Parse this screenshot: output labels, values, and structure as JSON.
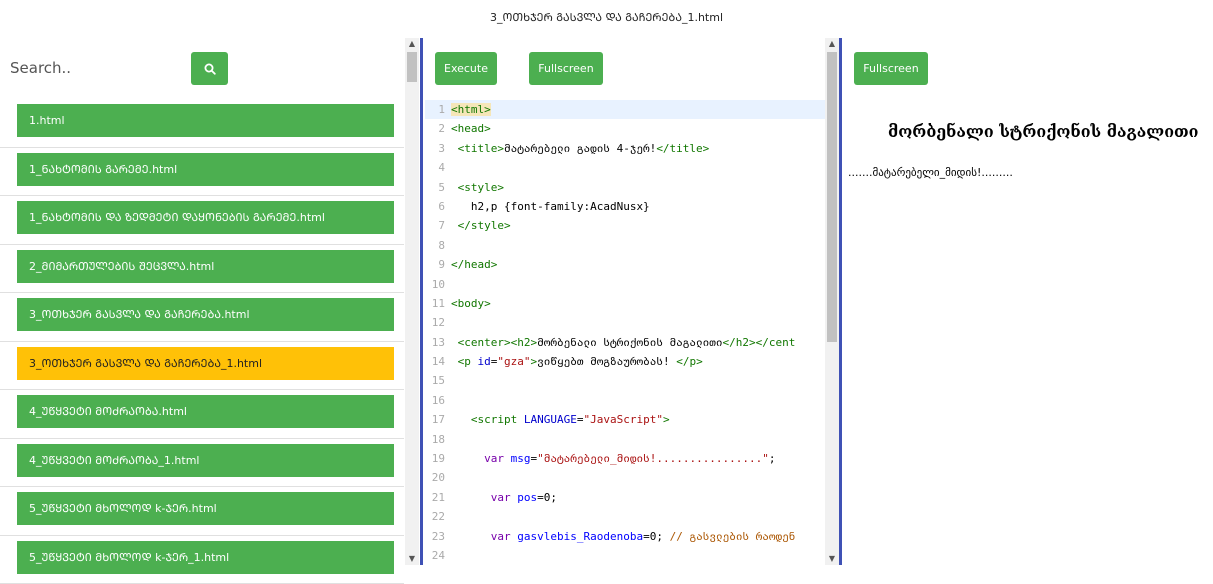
{
  "window": {
    "title": "3_ᲝᲗᲮᲯᲔᲠ ᲒᲐᲡᲕᲚᲐ ᲓᲐ ᲒᲐᲩᲔᲠᲔᲑᲐ_1.html"
  },
  "search": {
    "placeholder": "Search..",
    "icon": "search-icon"
  },
  "files": [
    {
      "label": "1.html"
    },
    {
      "label": "1_ᲜᲐᲮᲢᲝᲛᲘᲡ ᲒᲐᲠᲔᲛᲔ.html"
    },
    {
      "label": "1_ᲜᲐᲮᲢᲝᲛᲘᲡ ᲓᲐ ᲖᲔᲓᲛᲔᲢᲘ ᲓᲐᲧᲝᲜᲔᲑᲘᲡ ᲒᲐᲠᲔᲛᲔ.html"
    },
    {
      "label": "2_ᲛᲘᲛᲐᲠᲗᲣᲚᲔᲑᲘᲡ ᲨᲔᲪᲕᲚᲐ.html"
    },
    {
      "label": "3_ᲝᲗᲮᲯᲔᲠ ᲒᲐᲡᲕᲚᲐ ᲓᲐ ᲒᲐᲩᲔᲠᲔᲑᲐ.html"
    },
    {
      "label": "3_ᲝᲗᲮᲯᲔᲠ ᲒᲐᲡᲕᲚᲐ ᲓᲐ ᲒᲐᲩᲔᲠᲔᲑᲐ_1.html",
      "active": true
    },
    {
      "label": "4_ᲣᲬᲧᲕᲔᲢᲘ ᲛᲝᲫᲠᲐᲝᲑᲐ.html"
    },
    {
      "label": "4_ᲣᲬᲧᲕᲔᲢᲘ ᲛᲝᲫᲠᲐᲝᲑᲐ_1.html"
    },
    {
      "label": "5_ᲣᲬᲧᲕᲔᲢᲘ ᲛᲮᲝᲚᲝᲓ k-ᲯᲔᲠ.html"
    },
    {
      "label": "5_ᲣᲬᲧᲕᲔᲢᲘ ᲛᲮᲝᲚᲝᲓ k-ᲯᲔᲠ_1.html"
    }
  ],
  "toolbar": {
    "execute_label": "Execute",
    "fullscreen_label": "Fullscreen"
  },
  "preview": {
    "fullscreen_label": "Fullscreen",
    "heading": "მორბენალი სტრიქონის მაგალითი",
    "text": ".......მატარებელი_მიდის!........."
  },
  "code": {
    "line_numbers": [
      "1",
      "2",
      "3",
      "4",
      "5",
      "6",
      "7",
      "8",
      "9",
      "10",
      "11",
      "12",
      "13",
      "14",
      "15",
      "16",
      "17",
      "18",
      "19",
      "20",
      "21",
      "22",
      "23",
      "24"
    ],
    "l1": "<html>",
    "l2": "<head>",
    "l3a": "<title>",
    "l3b": "მატარებელი გადის 4-ჯერ!",
    "l3c": "</title>",
    "l5": "<style>",
    "l6": "h2,p {font-family:AcadNusx}",
    "l7": "</style>",
    "l9": "</head>",
    "l11": "<body>",
    "l13a": "<center><h2>",
    "l13b": "მორბენალი სტრიქონის მაგალითი",
    "l13c": "</h2></cent",
    "l14a": "<p ",
    "l14b": "id",
    "l14c": "=",
    "l14d": "\"gza\"",
    "l14e": ">",
    "l14f": "ვიწყებთ მოგზაურობას! ",
    "l14g": "</p>",
    "l17a": "<script ",
    "l17b": "LANGUAGE",
    "l17c": "=",
    "l17d": "\"JavaScript\"",
    "l17e": ">",
    "l19a": "var",
    "l19b": "msg",
    "l19c": "=",
    "l19d": "\"მატარებელი_მიდის!................\"",
    "l19e": ";",
    "l21a": "var",
    "l21b": "pos",
    "l21c": "=0;",
    "l23a": "var",
    "l23b": "gasvlebis_Raodenoba",
    "l23c": "=0; ",
    "l23d": "// გასვლების რაოდენ"
  }
}
